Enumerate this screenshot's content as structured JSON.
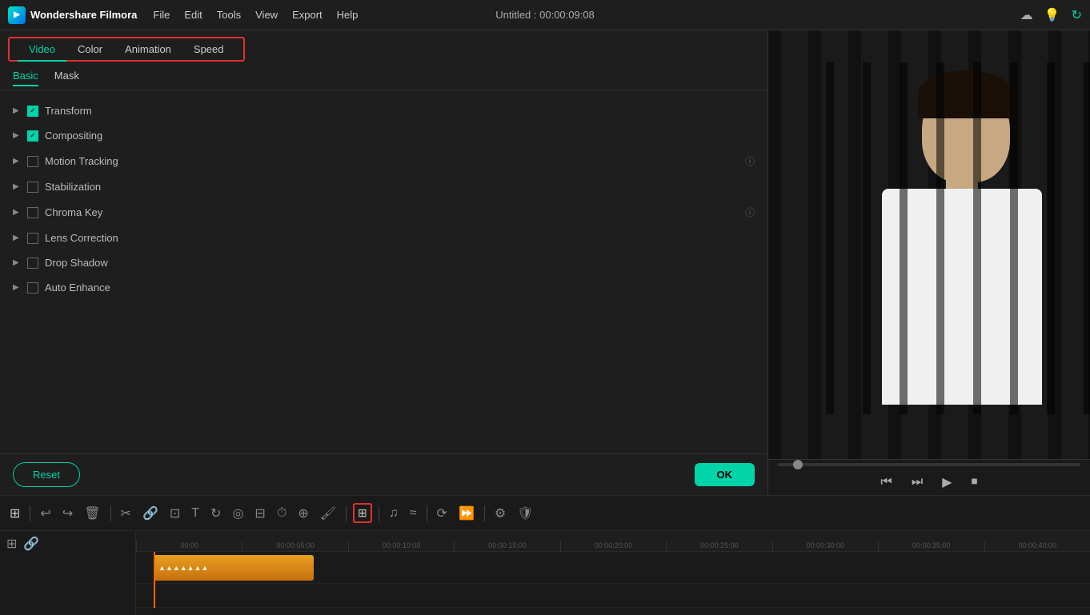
{
  "app": {
    "name": "Wondershare Filmora",
    "logo_char": "▶"
  },
  "menubar": {
    "title": "Untitled : 00:00:09:08",
    "items": [
      "File",
      "Edit",
      "Tools",
      "View",
      "Export",
      "Help"
    ],
    "icons": [
      "cloud-icon",
      "bulb-icon",
      "refresh-icon"
    ]
  },
  "tabs": {
    "items": [
      "Video",
      "Color",
      "Animation",
      "Speed"
    ],
    "active": "Video"
  },
  "subtabs": {
    "items": [
      "Basic",
      "Mask"
    ],
    "active": "Basic"
  },
  "properties": [
    {
      "id": "transform",
      "label": "Transform",
      "checked": true,
      "has_help": false
    },
    {
      "id": "compositing",
      "label": "Compositing",
      "checked": true,
      "has_help": false
    },
    {
      "id": "motion-tracking",
      "label": "Motion Tracking",
      "checked": false,
      "has_help": true
    },
    {
      "id": "stabilization",
      "label": "Stabilization",
      "checked": false,
      "has_help": false
    },
    {
      "id": "chroma-key",
      "label": "Chroma Key",
      "checked": false,
      "has_help": true
    },
    {
      "id": "lens-correction",
      "label": "Lens Correction",
      "checked": false,
      "has_help": false
    },
    {
      "id": "drop-shadow",
      "label": "Drop Shadow",
      "checked": false,
      "has_help": false
    },
    {
      "id": "auto-enhance",
      "label": "Auto Enhance",
      "checked": false,
      "has_help": false
    }
  ],
  "buttons": {
    "reset": "Reset",
    "ok": "OK"
  },
  "timeline": {
    "toolbar_icons": [
      "grid-icon",
      "undo-icon",
      "redo-icon",
      "trash-icon",
      "scissors-icon",
      "link-icon",
      "crop-icon",
      "text-icon",
      "rotate-icon",
      "mask-icon",
      "pip-icon",
      "speed-icon",
      "zoom-icon",
      "paint-icon",
      "equalizer-icon",
      "audio-icon",
      "ripple-icon",
      "loop-icon",
      "forward-icon",
      "settings-icon",
      "shield-icon"
    ],
    "ruler_marks": [
      "00:00",
      "00:00:05:00",
      "00:00:10:00",
      "00:00:15:00",
      "00:00:20:00",
      "00:00:25:00",
      "00:00:30:00",
      "00:00:35:00",
      "00:00:40:00"
    ]
  },
  "preview": {
    "progress": 5
  }
}
